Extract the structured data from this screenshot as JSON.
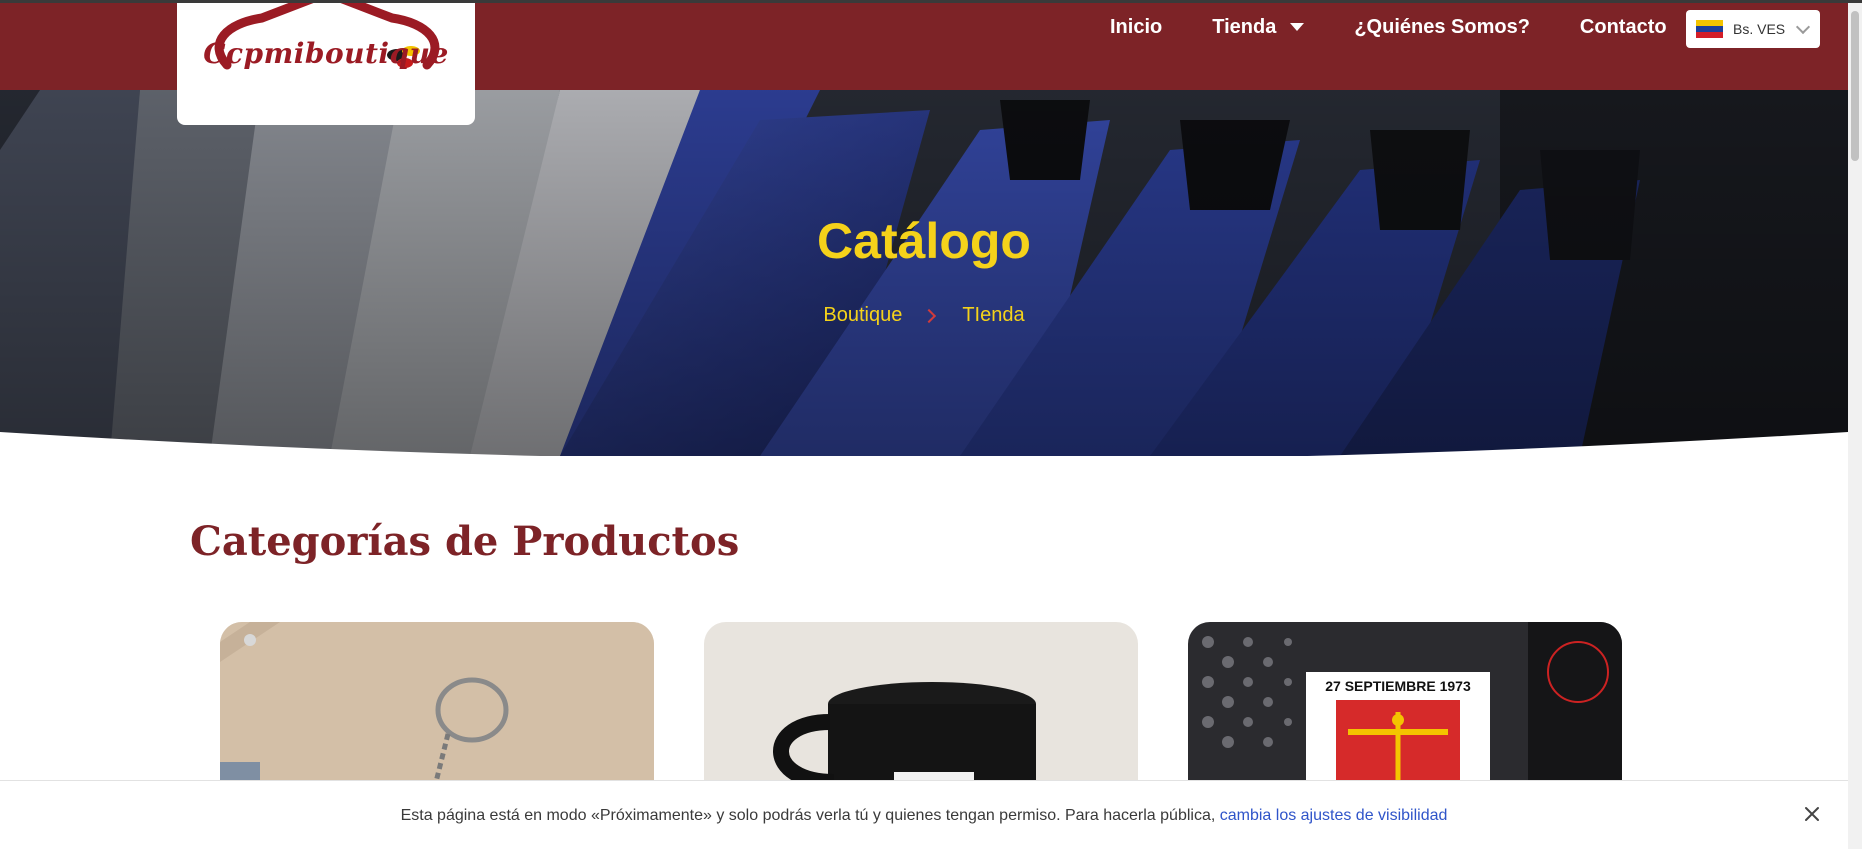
{
  "brand": {
    "logo_text": "Ccpmiboutique"
  },
  "nav": {
    "items": [
      {
        "label": "Inicio"
      },
      {
        "label": "Tienda"
      },
      {
        "label": "¿Quiénes Somos?"
      },
      {
        "label": "Contacto"
      }
    ],
    "currency": {
      "label": "Bs. VES",
      "flag_icon": "venezuela-flag-icon"
    }
  },
  "hero": {
    "title": "Catálogo",
    "breadcrumb": [
      "Boutique",
      "TIenda"
    ]
  },
  "section": {
    "title": "Categorías de Productos"
  },
  "products": [
    {
      "image_icon": "keychain-image"
    },
    {
      "image_icon": "mug-image"
    },
    {
      "image_icon": "bag-print-image",
      "print_text": "27 SEPTIEMBRE 1973"
    }
  ],
  "notice": {
    "text": "Esta página está en modo «Próximamente» y solo podrás verla tú y quienes tengan permiso. Para hacerla pública, ",
    "link": "cambia los ajustes de visibilidad",
    "close_icon": "close-icon"
  },
  "colors": {
    "brand": "#7d2327",
    "accent": "#f5d21a",
    "link": "#2f54c9"
  }
}
